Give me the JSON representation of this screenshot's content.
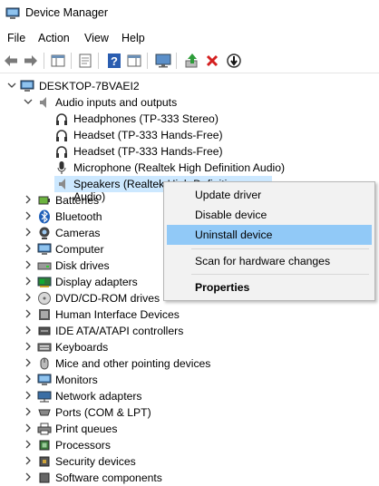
{
  "window": {
    "title": "Device Manager"
  },
  "menu": [
    "File",
    "Action",
    "View",
    "Help"
  ],
  "toolbar": [
    "back-icon",
    "forward-icon",
    "show-hide-tree-icon",
    "properties-icon",
    "help-icon",
    "action-pane-icon",
    "monitor-icon",
    "update-driver-icon",
    "uninstall-icon",
    "disable-icon"
  ],
  "tree": {
    "root": "DESKTOP-7BVAEI2",
    "audio_group": "Audio inputs and outputs",
    "audio_items": [
      "Headphones (TP-333 Stereo)",
      "Headset (TP-333 Hands-Free)",
      "Headset (TP-333 Hands-Free)",
      "Microphone (Realtek High Definition Audio)",
      "Speakers (Realtek High Definition Audio)"
    ],
    "categories": [
      "Batteries",
      "Bluetooth",
      "Cameras",
      "Computer",
      "Disk drives",
      "Display adapters",
      "DVD/CD-ROM drives",
      "Human Interface Devices",
      "IDE ATA/ATAPI controllers",
      "Keyboards",
      "Mice and other pointing devices",
      "Monitors",
      "Network adapters",
      "Ports (COM & LPT)",
      "Print queues",
      "Processors",
      "Security devices",
      "Software components"
    ]
  },
  "context_menu": {
    "update": "Update driver",
    "disable": "Disable device",
    "uninstall": "Uninstall device",
    "scan": "Scan for hardware changes",
    "properties": "Properties"
  },
  "colors": {
    "selection": "#cce8ff",
    "menu_highlight": "#91c9f7",
    "menu_bg": "#f2f2f2"
  }
}
